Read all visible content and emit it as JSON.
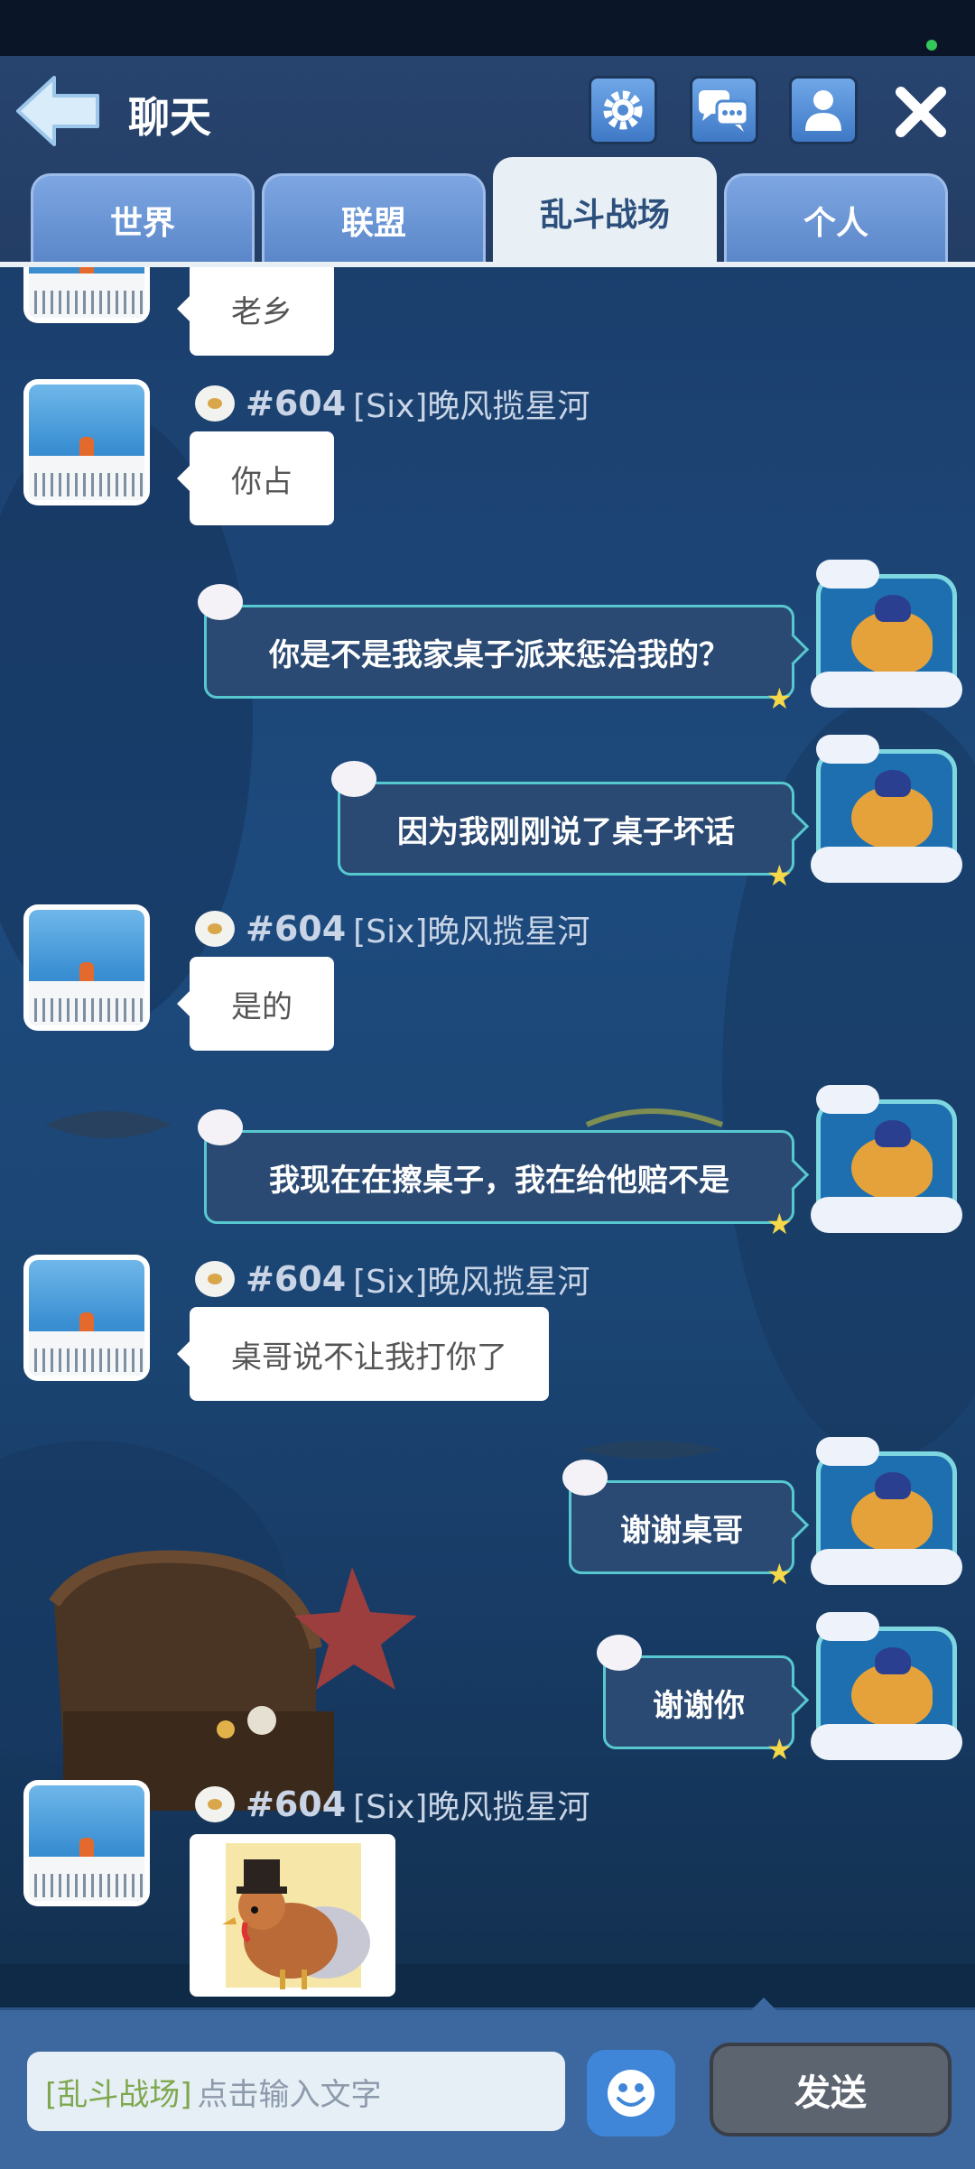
{
  "header": {
    "title": "聊天",
    "tabs": [
      {
        "label": "世界",
        "active": false
      },
      {
        "label": "联盟",
        "active": false
      },
      {
        "label": "乱斗战场",
        "active": true
      },
      {
        "label": "个人",
        "active": false
      }
    ]
  },
  "messages": [
    {
      "from": "other",
      "text": "老乡"
    },
    {
      "from": "other",
      "server": "#604",
      "name": "[Six]晚风揽星河",
      "text": "你占"
    },
    {
      "from": "me",
      "text": "你是不是我家桌子派来惩治我的？"
    },
    {
      "from": "me",
      "text": "因为我刚刚说了桌子坏话"
    },
    {
      "from": "other",
      "server": "#604",
      "name": "[Six]晚风揽星河",
      "text": "是的"
    },
    {
      "from": "me",
      "text": "我现在在擦桌子，我在给他赔不是"
    },
    {
      "from": "other",
      "server": "#604",
      "name": "[Six]晚风揽星河",
      "text": "桌哥说不让我打你了"
    },
    {
      "from": "me",
      "text": "谢谢桌哥"
    },
    {
      "from": "me",
      "text": "谢谢你"
    },
    {
      "from": "other",
      "server": "#604",
      "name": "[Six]晚风揽星河",
      "sticker": "turkey-sticker"
    }
  ],
  "input": {
    "channel": "[乱斗战场]",
    "placeholder": "点击输入文字",
    "send_label": "发送"
  },
  "colors": {
    "accent": "#57c8cf",
    "header": "#27446f",
    "active_tab": "#e8f0f6",
    "send_button": "#5c6470"
  }
}
